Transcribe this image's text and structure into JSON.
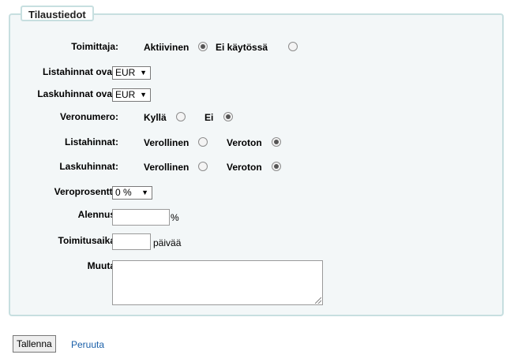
{
  "legend": "Tilaustiedot",
  "rows": {
    "toimittaja": {
      "label": "Toimittaja:",
      "opt1": "Aktiivinen",
      "opt2": "Ei käytössä"
    },
    "listahinnat_ovat": {
      "label": "Listahinnat ovat:",
      "value": "EUR"
    },
    "laskuhinnat_ovat": {
      "label": "Laskuhinnat ovat:",
      "value": "EUR"
    },
    "veronumero": {
      "label": "Veronumero:",
      "opt1": "Kyllä",
      "opt2": "Ei"
    },
    "listahinnat": {
      "label": "Listahinnat:",
      "opt1": "Verollinen",
      "opt2": "Veroton"
    },
    "laskuhinnat": {
      "label": "Laskuhinnat:",
      "opt1": "Verollinen",
      "opt2": "Veroton"
    },
    "veroprosentti": {
      "label": "Veroprosentti:",
      "value": "0 %"
    },
    "alennus": {
      "label": "Alennus:",
      "value": "",
      "suffix": "%"
    },
    "toimitusaika": {
      "label": "Toimitusaika:",
      "value": "",
      "suffix": "päivää"
    },
    "muuta": {
      "label": "Muuta:",
      "value": ""
    }
  },
  "actions": {
    "save": "Tallenna",
    "cancel": "Peruuta"
  }
}
